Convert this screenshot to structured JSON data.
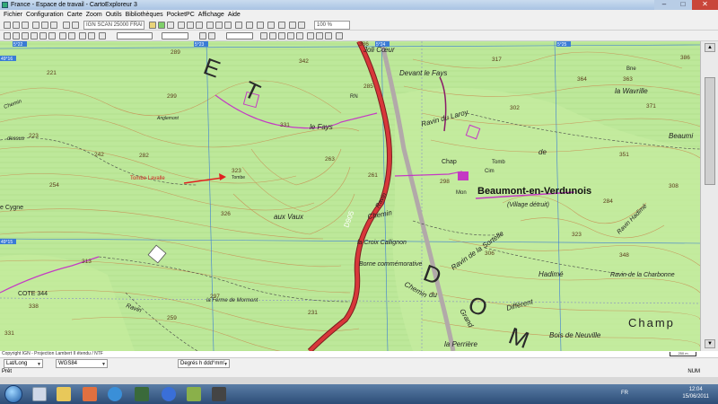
{
  "window": {
    "title": "France - Espace de travail - CartoExploreur 3",
    "controls": [
      "–",
      "□",
      "✕"
    ]
  },
  "menu": [
    "Fichier",
    "Configuration",
    "Carte",
    "Zoom",
    "Outils",
    "Bibliothèques",
    "PocketPC",
    "Affichage",
    "Aide"
  ],
  "toolbar": {
    "map_layer": "IGN SCAN 25000 FRAI",
    "zoom_level": "100 %"
  },
  "map": {
    "place_labels": {
      "joli_coeur": "Joli Cœur",
      "devant_le_fays": "Devant le Fays",
      "ravin_du_laroy": "Ravin du Laroy",
      "la_wavrille": "la Wavrille",
      "bne": "Bne",
      "beaumont": "Beaumont-en-Verdunois",
      "village_detruit": "(Village détruit)",
      "chap": "Chap",
      "tomb": "Tomb",
      "cim": "Cim",
      "mon": "Mon",
      "de": "de",
      "le_fays": "le Fays",
      "aux_vaux": "aux Vaux",
      "tombe_lavalle": "Tombe Lavalle",
      "tombe_small": "Tombe",
      "la_croix_callignon": "la Croix Callignon",
      "borne_commemorative": "Borne commémorative",
      "ravin_de_la_sortelle": "Ravin de la Sortelle",
      "hadime": "Hadimé",
      "ravin_de_la_charbonne": "Ravin de la Charbonne",
      "different": "Différent",
      "grand": "Grand",
      "chemin": "Chemin",
      "chemin2": "Chemin",
      "du": "du",
      "bois_de_neuville": "Bois de Neuville",
      "champ": "Champ",
      "la_perriere": "la Perrière",
      "la_ferme_de_mormont": "la Ferme de Mormont",
      "cote_344": "COTE 344",
      "cygne": "e Cygne",
      "d905": "D905",
      "rn": "RN",
      "ravin_left": "Ravin",
      "ravin_mid": "Ravin",
      "ravin_hadime": "Ravin Hadimé",
      "beaumi": "Beaumi",
      "letter_d": "D",
      "letter_o": "O",
      "letter_m": "M",
      "letter_e": "E",
      "letter_t": "T",
      "chemin_left": "Chemin",
      "dessus": "dessus",
      "anglemont": "Anglemont"
    },
    "spot_heights": [
      "289",
      "342",
      "221",
      "299",
      "331",
      "223",
      "242",
      "254",
      "282",
      "323",
      "263",
      "326",
      "313",
      "297",
      "338",
      "259",
      "331",
      "231",
      "285",
      "261",
      "298",
      "302",
      "317",
      "363",
      "371",
      "308",
      "351",
      "364",
      "386",
      "323",
      "348",
      "284",
      "306",
      "386"
    ],
    "grid_labels": [
      "5°22",
      "5°23",
      "5°24",
      "5°25",
      "49°16",
      "49°15"
    ]
  },
  "copyright": "Copyright IGN - Projection Lambert II étendu / NTF",
  "scale_label": "250 m",
  "status": {
    "coord_system": "Lat/Long",
    "datum": "WGS84",
    "format": "Degrés h ddd°mm'",
    "left_text": "Prêt",
    "right_text": "NUM"
  },
  "taskbar": {
    "lang": "FR",
    "time": "12:04",
    "date": "15/06/2011"
  }
}
